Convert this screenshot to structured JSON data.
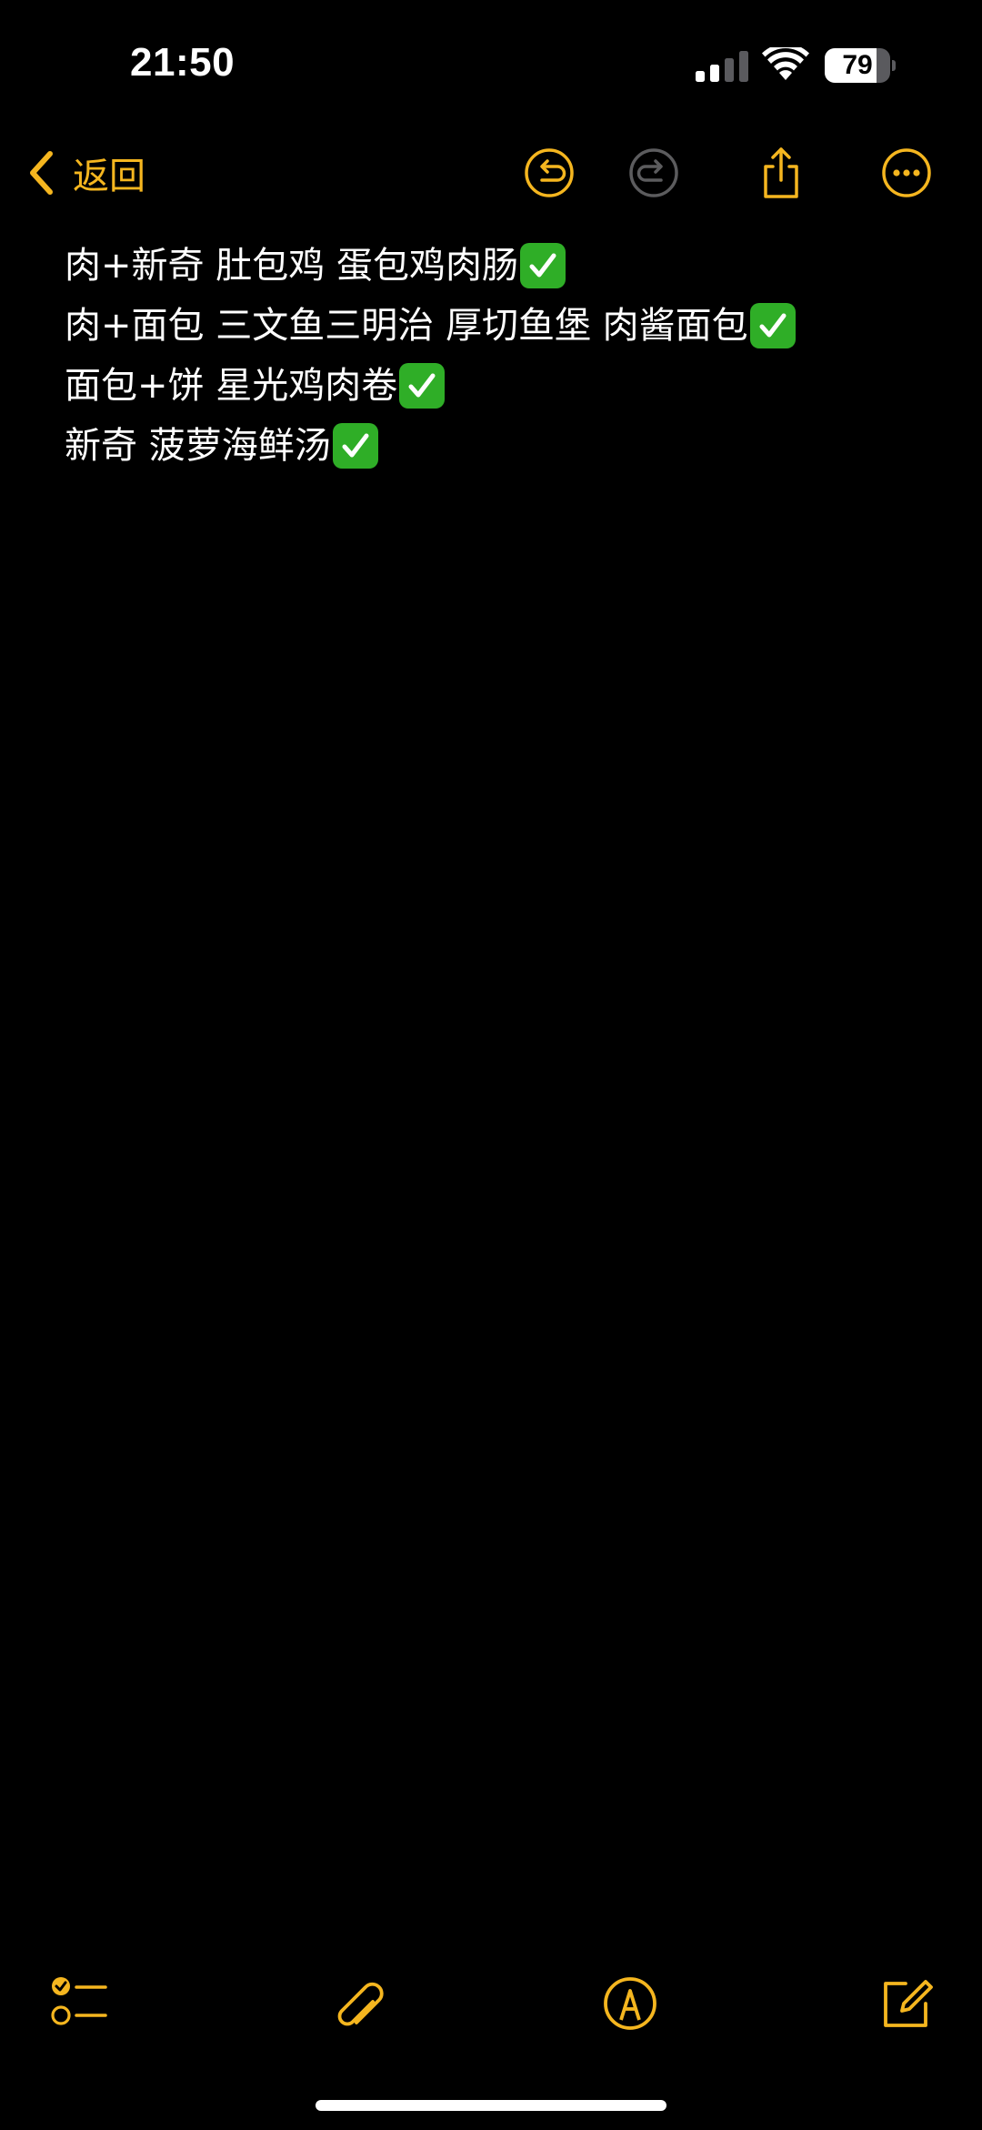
{
  "status_bar": {
    "time": "21:50",
    "battery_level": "79",
    "battery_fraction": 0.79,
    "signal_icon": "cellular-signal-icon",
    "wifi_icon": "wifi-icon"
  },
  "nav_bar": {
    "back_label": "返回",
    "back_icon": "chevron-left-icon",
    "undo_icon": "undo-icon",
    "redo_icon": "redo-icon",
    "share_icon": "share-icon",
    "more_icon": "more-options-icon",
    "accent_color": "#f5b61f",
    "disabled_color": "#5c5c5e"
  },
  "note": {
    "lines": [
      "肉+新奇 肚包鸡 蛋包鸡肉肠",
      "肉+面包 三文鱼三明治 厚切鱼堡 肉酱面包",
      "面包+饼 星光鸡肉卷",
      "新奇 菠萝海鲜汤"
    ],
    "line_check_icon": "green-check-box-icon",
    "check_color": "#2fae27"
  },
  "toolbar": {
    "checklist_icon": "checklist-icon",
    "attachment_icon": "paperclip-icon",
    "markup_icon": "markup-pen-icon",
    "compose_icon": "compose-icon"
  }
}
